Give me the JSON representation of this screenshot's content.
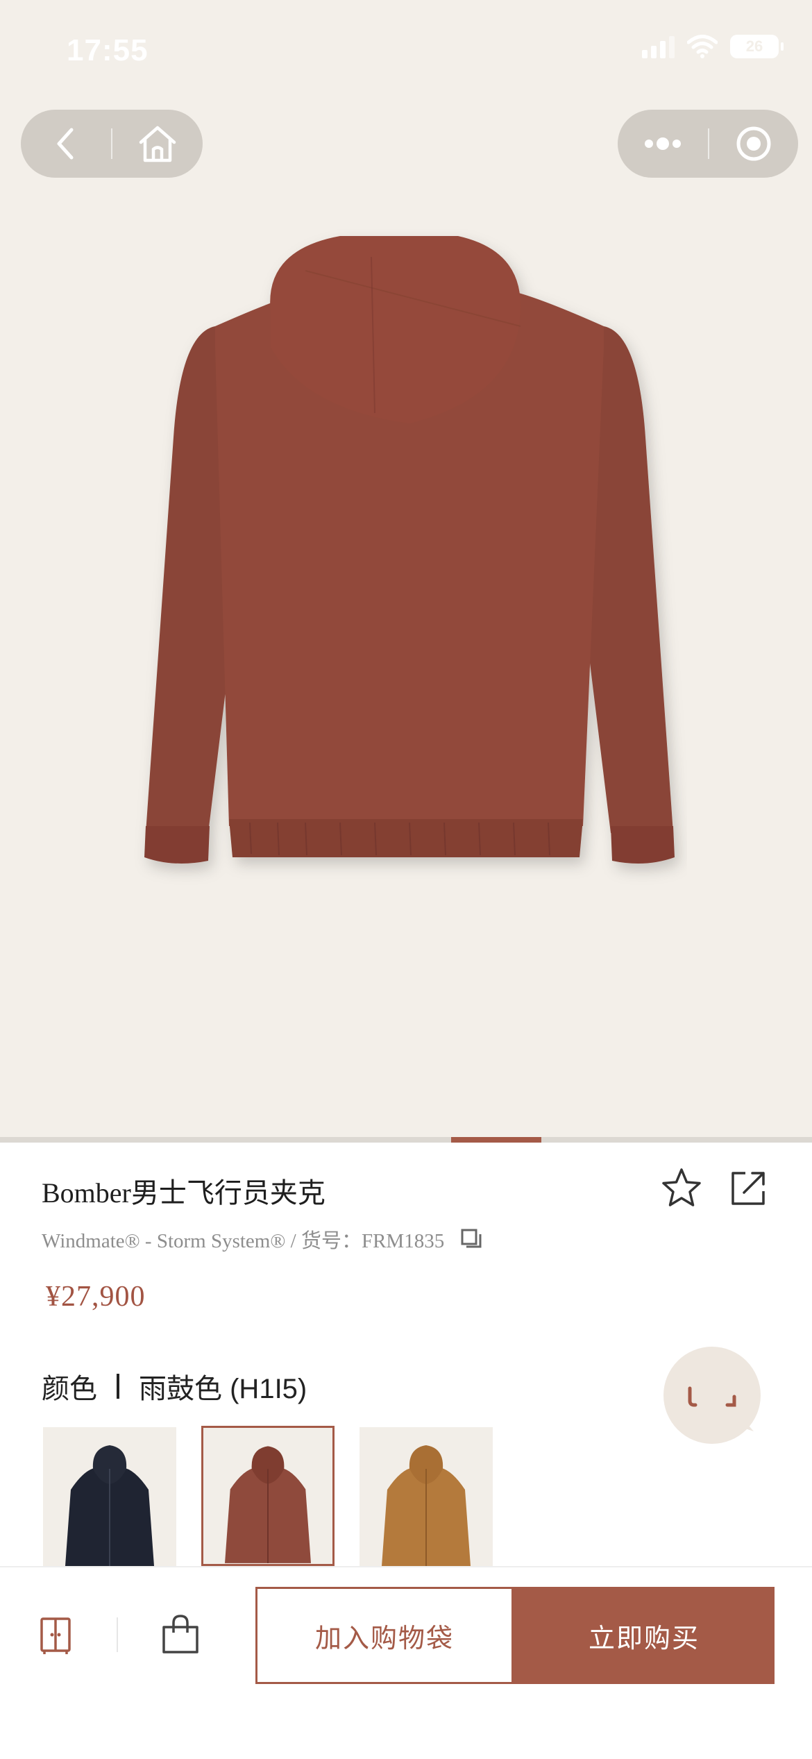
{
  "status_bar": {
    "time": "17:55",
    "battery": "26",
    "icons": [
      "signal-icon",
      "wifi-icon",
      "battery-icon"
    ]
  },
  "mini_program_capsules": {
    "left": [
      "back-icon",
      "home-icon"
    ],
    "right": [
      "more-icon",
      "close-circle-icon"
    ]
  },
  "product": {
    "title": "Bomber男士飞行员夹克",
    "subtitle": "Windmate® - Storm System® / 货号：FRM1835",
    "price": "¥27,900",
    "color_label": "颜色",
    "color_value": "雨鼓色 (H1I5)",
    "selected_swatch_index": 1,
    "swatches": [
      "navy",
      "rust",
      "camel"
    ]
  },
  "colors": {
    "accent": "#a45a47",
    "hero_background": "#f3efe9",
    "jacket_rust": "#8f4a3c",
    "jacket_navy": "#1f2432",
    "jacket_camel": "#b47a3c"
  },
  "carousel": {
    "active_index": 5,
    "total": 9
  },
  "bottom_bar": {
    "add_to_bag": "加入购物袋",
    "buy_now": "立即购买",
    "icons": [
      "wardrobe-icon",
      "shopping-bag-icon"
    ]
  }
}
